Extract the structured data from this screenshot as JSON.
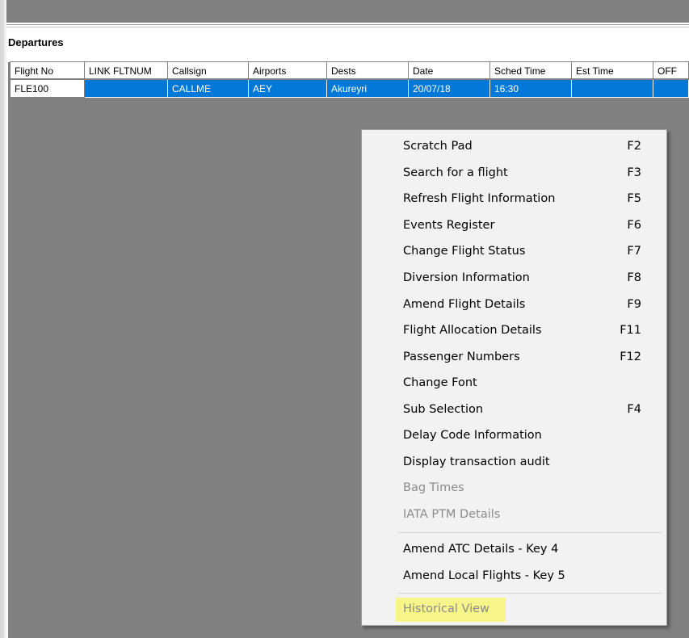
{
  "section_title": "Departures",
  "table": {
    "columns": [
      "Flight No",
      "LINK FLTNUM",
      "Callsign",
      "Airports",
      "Dests",
      "Date",
      "Sched Time",
      "Est Time",
      "OFF"
    ],
    "rows": [
      [
        "FLE100",
        "",
        "CALLME",
        "AEY",
        "Akureyri",
        "20/07/18",
        "16:30",
        "",
        ""
      ]
    ]
  },
  "context_menu": {
    "items": [
      {
        "label": "Scratch Pad",
        "key": "F2",
        "enabled": true
      },
      {
        "label": "Search for a flight",
        "key": "F3",
        "enabled": true
      },
      {
        "label": "Refresh Flight Information",
        "key": "F5",
        "enabled": true
      },
      {
        "label": "Events Register",
        "key": "F6",
        "enabled": true
      },
      {
        "label": "Change Flight Status",
        "key": "F7",
        "enabled": true
      },
      {
        "label": "Diversion Information",
        "key": "F8",
        "enabled": true
      },
      {
        "label": "Amend Flight Details",
        "key": "F9",
        "enabled": true
      },
      {
        "label": "Flight Allocation Details",
        "key": "F11",
        "enabled": true
      },
      {
        "label": "Passenger Numbers",
        "key": "F12",
        "enabled": true
      },
      {
        "label": "Change Font",
        "key": "",
        "enabled": true
      },
      {
        "label": "Sub Selection",
        "key": "F4",
        "enabled": true
      },
      {
        "label": "Delay Code Information",
        "key": "",
        "enabled": true
      },
      {
        "label": "Display transaction audit",
        "key": "",
        "enabled": true
      },
      {
        "label": "Bag Times",
        "key": "",
        "enabled": false
      },
      {
        "label": "IATA PTM Details",
        "key": "",
        "enabled": false
      },
      {
        "label": "Amend ATC Details - Key 4",
        "key": "",
        "enabled": true
      },
      {
        "label": "Amend Local Flights - Key 5",
        "key": "",
        "enabled": true
      },
      {
        "label": "Historical View",
        "key": "",
        "enabled": false
      }
    ],
    "highlight_color": "#f7f58a"
  },
  "colors": {
    "selection": "#0078d7",
    "background": "#808080",
    "menu_bg": "#f2f2f2"
  }
}
